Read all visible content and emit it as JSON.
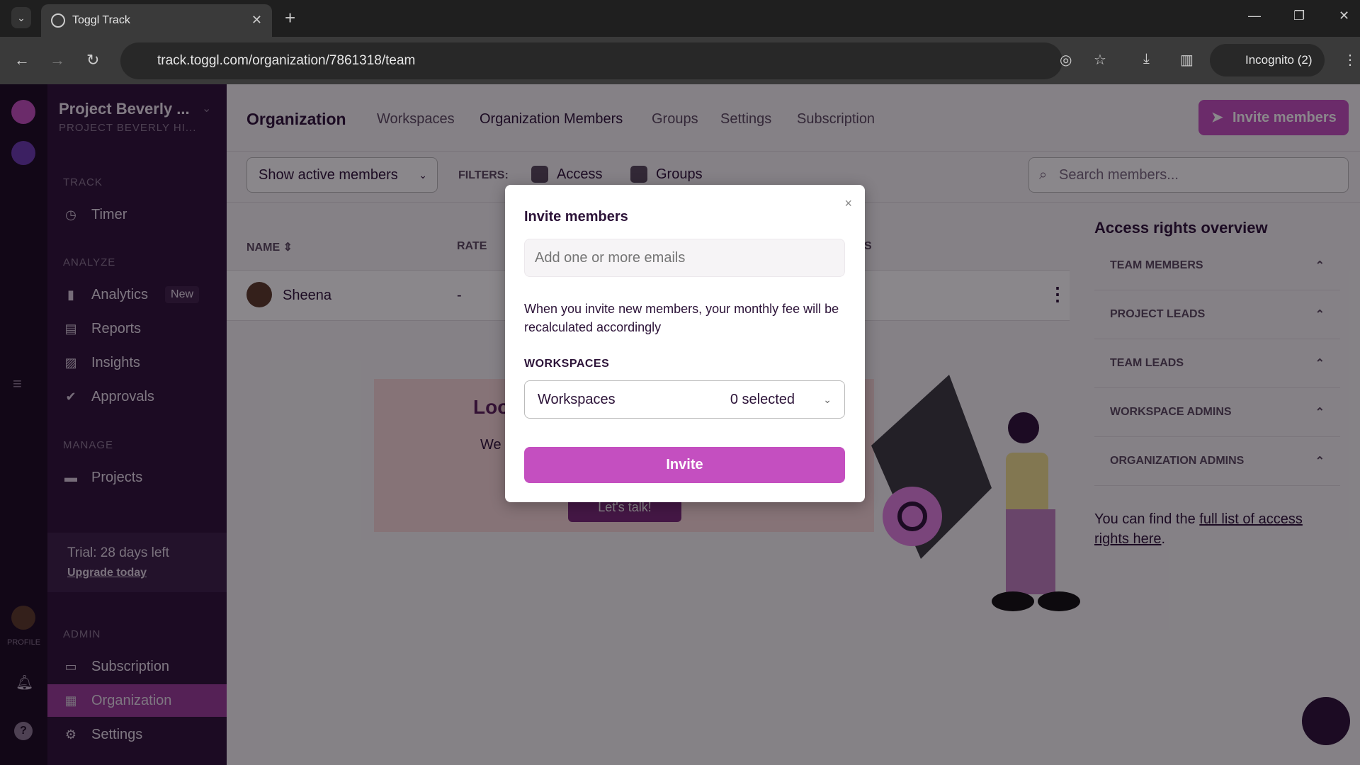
{
  "browser": {
    "tab_title": "Toggl Track",
    "url": "track.toggl.com/organization/7861318/team",
    "incognito": "Incognito (2)"
  },
  "sidebar": {
    "workspace": "Project Beverly ...",
    "workspace_sub": "PROJECT BEVERLY HI...",
    "profile": "PROFILE",
    "sections": {
      "track": "TRACK",
      "analyze": "ANALYZE",
      "manage": "MANAGE",
      "admin": "ADMIN"
    },
    "items": [
      {
        "label": "Timer",
        "icon": "clock-icon"
      },
      {
        "label": "Analytics",
        "icon": "bar-chart-icon",
        "badge": "New"
      },
      {
        "label": "Reports",
        "icon": "report-icon"
      },
      {
        "label": "Insights",
        "icon": "insights-icon"
      },
      {
        "label": "Approvals",
        "icon": "check-circle-icon"
      },
      {
        "label": "Projects",
        "icon": "folder-icon"
      },
      {
        "label": "Subscription",
        "icon": "card-icon"
      },
      {
        "label": "Organization",
        "icon": "building-icon",
        "active": true
      },
      {
        "label": "Settings",
        "icon": "gear-icon"
      }
    ],
    "trial": "Trial: 28 days left",
    "upgrade": "Upgrade today"
  },
  "header": {
    "title": "Organization",
    "tabs": [
      "Workspaces",
      "Organization Members",
      "Groups",
      "Settings",
      "Subscription"
    ],
    "invite": "Invite members"
  },
  "filters": {
    "show": "Show active members",
    "label": "FILTERS:",
    "access": "Access",
    "groups": "Groups",
    "search_placeholder": "Search members..."
  },
  "table": {
    "columns": [
      "NAME",
      "RATE",
      "S"
    ],
    "rows": [
      {
        "name": "Sheena",
        "rate": "-"
      }
    ]
  },
  "promo": {
    "title": "Loo",
    "text": "We",
    "button": "Let's talk!"
  },
  "access": {
    "title": "Access rights overview",
    "items": [
      "TEAM MEMBERS",
      "PROJECT LEADS",
      "TEAM LEADS",
      "WORKSPACE ADMINS",
      "ORGANIZATION ADMINS"
    ],
    "note_pre": "You can find the ",
    "note_link": "full list of access rights here",
    "note_post": "."
  },
  "modal": {
    "title": "Invite members",
    "close": "×",
    "email_placeholder": "Add one or more emails",
    "note": "When you invite new members, your monthly fee will be recalculated accordingly",
    "ws_label": "WORKSPACES",
    "ws_select": "Workspaces",
    "ws_count": "0 selected",
    "invite": "Invite"
  },
  "colors": {
    "brand": "#c44fc0",
    "sidebar": "#2c1338"
  }
}
